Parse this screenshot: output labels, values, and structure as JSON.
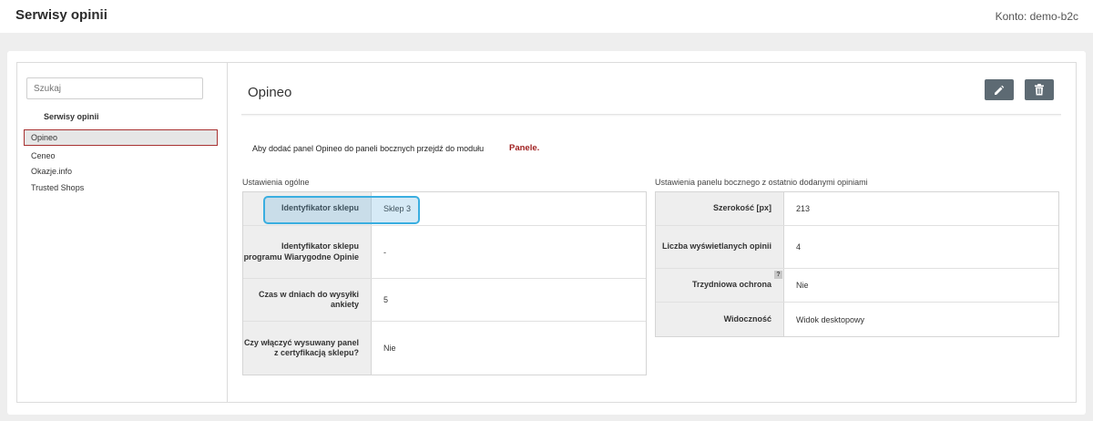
{
  "header": {
    "title": "Serwisy opinii",
    "account": "Konto: demo-b2c"
  },
  "sidebar": {
    "search_placeholder": "Szukaj",
    "heading": "Serwisy opinii",
    "items": [
      {
        "label": "Opineo",
        "active": true
      },
      {
        "label": "Ceneo"
      },
      {
        "label": "Okazje.info"
      },
      {
        "label": "Trusted Shops"
      }
    ]
  },
  "main": {
    "title": "Opineo",
    "info_text": "Aby dodać panel Opineo do paneli bocznych przejdź do modułu",
    "info_link": "Panele.",
    "general": {
      "label": "Ustawienia ogólne",
      "rows": [
        {
          "label": "Identyfikator sklepu",
          "value": "Sklep 3"
        },
        {
          "label": "Identyfikator sklepu programu Wiarygodne Opinie",
          "value": "-"
        },
        {
          "label": "Czas w dniach do wysyłki ankiety",
          "value": "5"
        },
        {
          "label": "Czy włączyć wysuwany panel z certyfikacją sklepu?",
          "value": "Nie"
        }
      ]
    },
    "sidepanel": {
      "label": "Ustawienia panelu bocznego z ostatnio dodanymi opiniami",
      "rows": [
        {
          "label": "Szerokość [px]",
          "value": "213"
        },
        {
          "label": "Liczba wyświetlanych opinii",
          "value": "4"
        },
        {
          "label": "Trzydniowa ochrona",
          "value": "Nie",
          "help": "?"
        },
        {
          "label": "Widoczność",
          "value": "Widok desktopowy"
        }
      ]
    }
  },
  "icons": {
    "edit": "pencil-icon",
    "delete": "trash-icon"
  },
  "colors": {
    "button": "#5d6a73",
    "active_border": "#a83232",
    "link": "#a02020",
    "highlight": "#3aaee0"
  }
}
